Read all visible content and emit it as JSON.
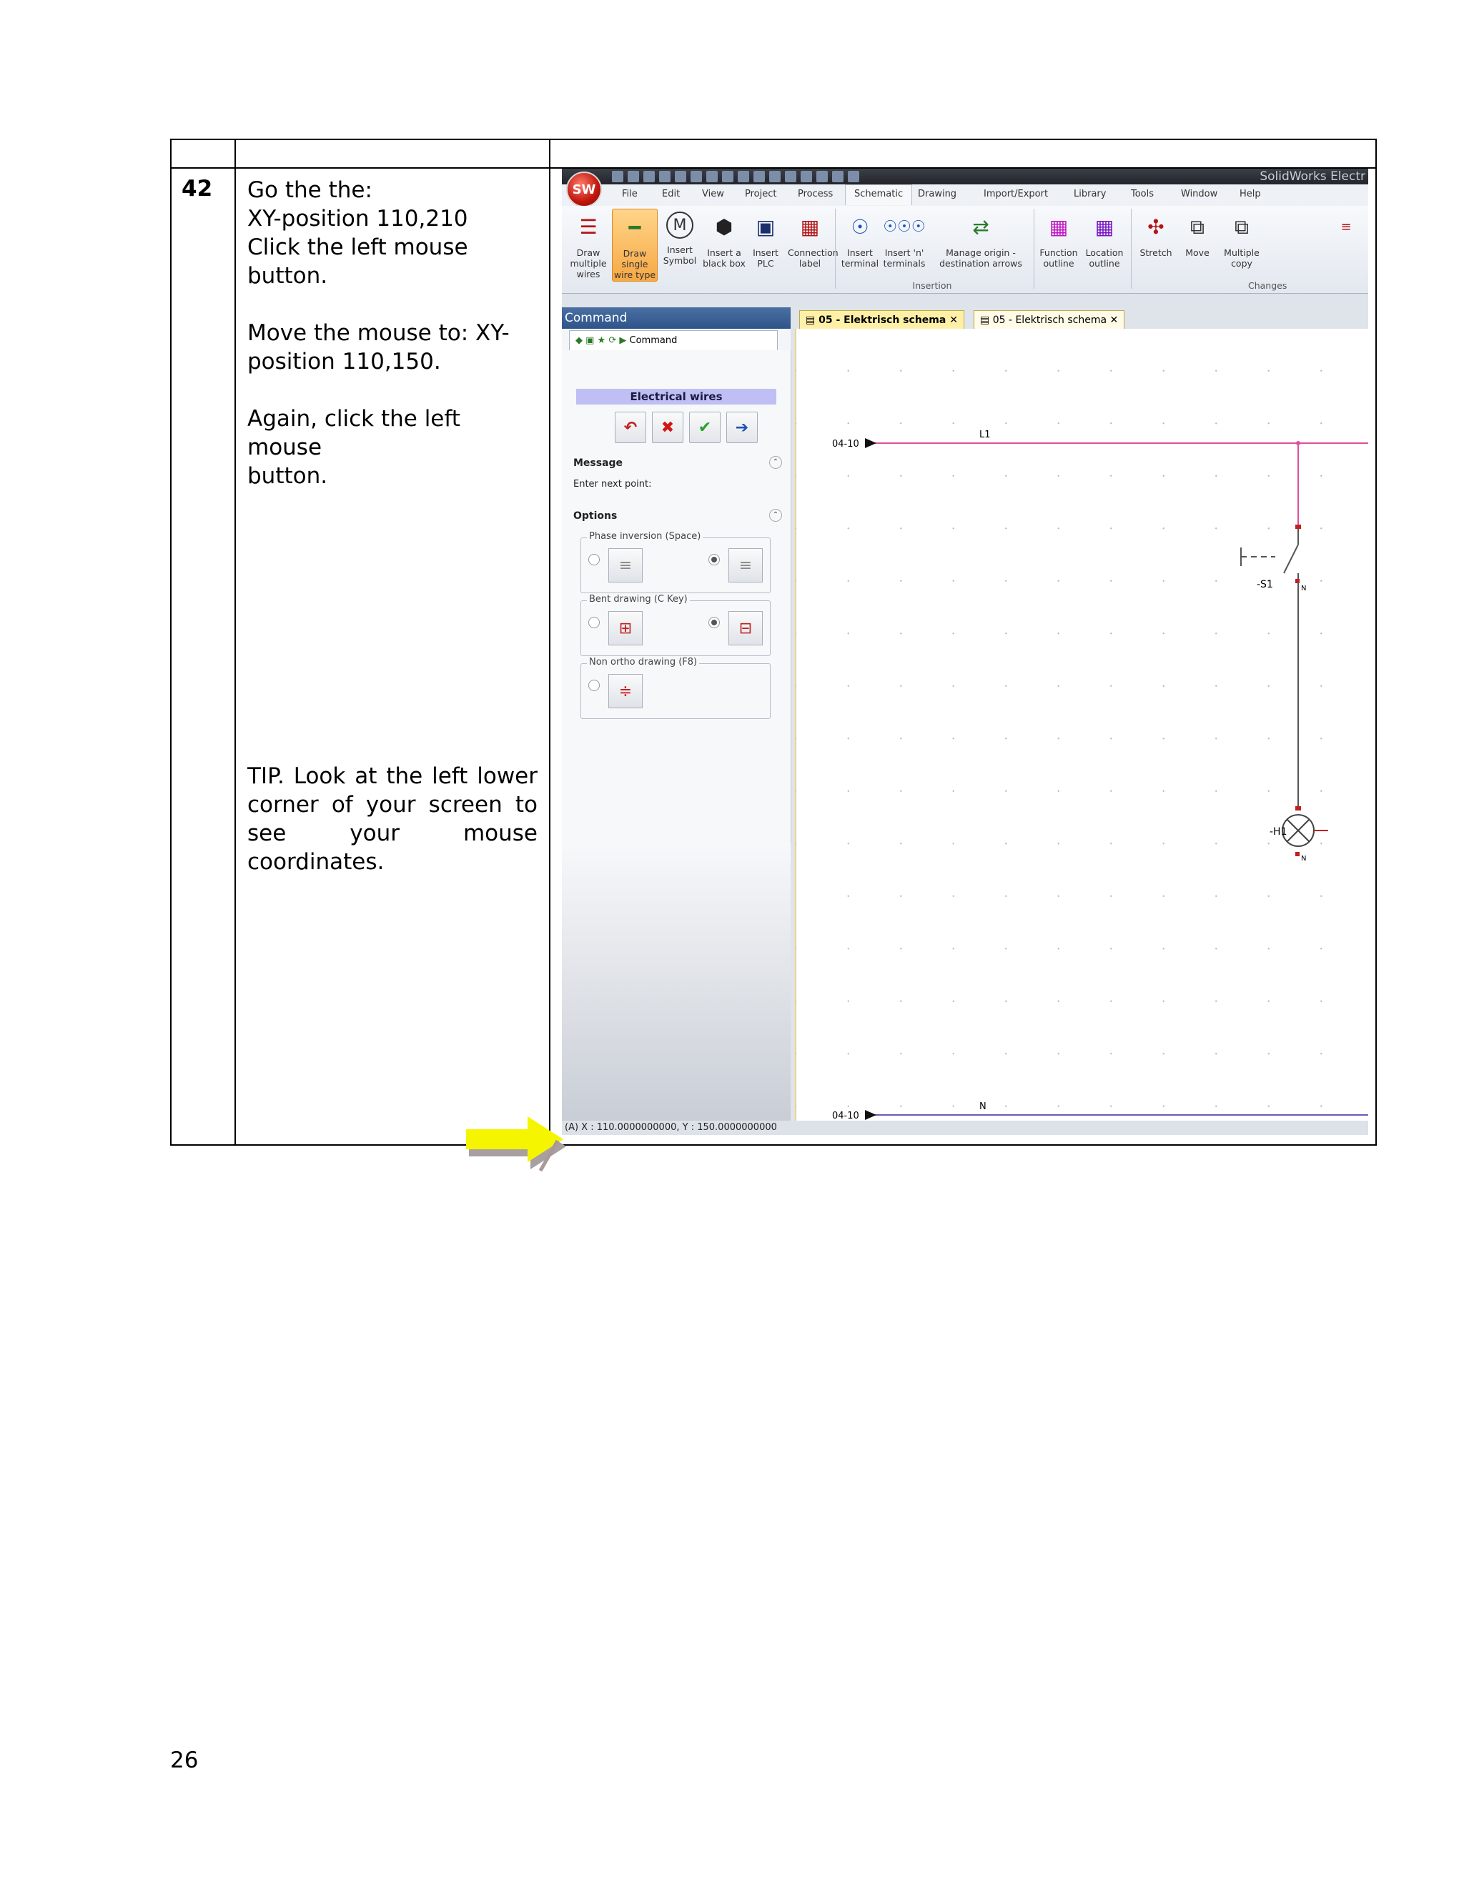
{
  "step": {
    "number": "42",
    "instructions": [
      "Go the the:",
      "XY-position 110,210",
      "Click the left mouse",
      "button."
    ],
    "move_text": [
      "Move the mouse to: XY-",
      "position 110,150."
    ],
    "again_text": [
      "Again, click the left mouse",
      "button."
    ],
    "tip": "TIP. Look at the left lower corner of your screen to see your mouse coordinates."
  },
  "page_number": "26",
  "screenshot": {
    "app_title": "SolidWorks Electr",
    "menu": [
      "File",
      "Edit",
      "View",
      "Project",
      "Process",
      "Schematic",
      "Drawing",
      "Import/Export",
      "Library",
      "Tools",
      "Window",
      "Help"
    ],
    "active_menu": "Schematic",
    "ribbon_buttons": [
      {
        "label": "Draw multiple wires",
        "icon": "multi-wire-icon"
      },
      {
        "label": "Draw single wire type",
        "icon": "single-wire-icon"
      },
      {
        "label": "Insert Symbol",
        "icon": "motor-symbol-icon"
      },
      {
        "label": "Insert a black box",
        "icon": "black-box-icon"
      },
      {
        "label": "Insert PLC",
        "icon": "plc-icon"
      },
      {
        "label": "Connection label",
        "icon": "connection-label-icon"
      },
      {
        "label": "Insert terminal",
        "icon": "terminal-icon"
      },
      {
        "label": "Insert 'n' terminals",
        "icon": "terminals-icon"
      },
      {
        "label": "Manage origin - destination arrows",
        "icon": "arrows-icon"
      },
      {
        "label": "Function outline",
        "icon": "function-outline-icon"
      },
      {
        "label": "Location outline",
        "icon": "location-outline-icon"
      },
      {
        "label": "Stretch",
        "icon": "stretch-icon"
      },
      {
        "label": "Move",
        "icon": "move-icon"
      },
      {
        "label": "Multiple copy",
        "icon": "multiple-copy-icon"
      }
    ],
    "ribbon_groups": {
      "insertion": "Insertion",
      "changes": "Changes"
    },
    "command_panel": {
      "title": "Command",
      "tab_label": "Command",
      "section_title": "Electrical wires",
      "message_label": "Message",
      "message_text": "Enter next point:",
      "options_label": "Options",
      "phase_inversion": "Phase inversion (Space)",
      "bent_drawing": "Bent drawing (C Key)",
      "non_ortho": "Non ortho drawing (F8)"
    },
    "doc_tabs": [
      "05 - Elektrisch schema",
      "05 - Elektrisch schema"
    ],
    "schematic": {
      "wire_top_label": "L1",
      "wire_bottom_label": "N",
      "ref_top": "04-10",
      "ref_bottom": "04-10",
      "switch_label": "-S1",
      "lamp_label": "-H1",
      "n_label_1": "N",
      "n_label_2": "N"
    },
    "status_text": "(A) X : 110.0000000000, Y : 150.0000000000",
    "colors": {
      "wire_top": "#e0509a",
      "wire_bottom": "#6e5ab8",
      "highlight_arrow": "#f5f500"
    }
  }
}
